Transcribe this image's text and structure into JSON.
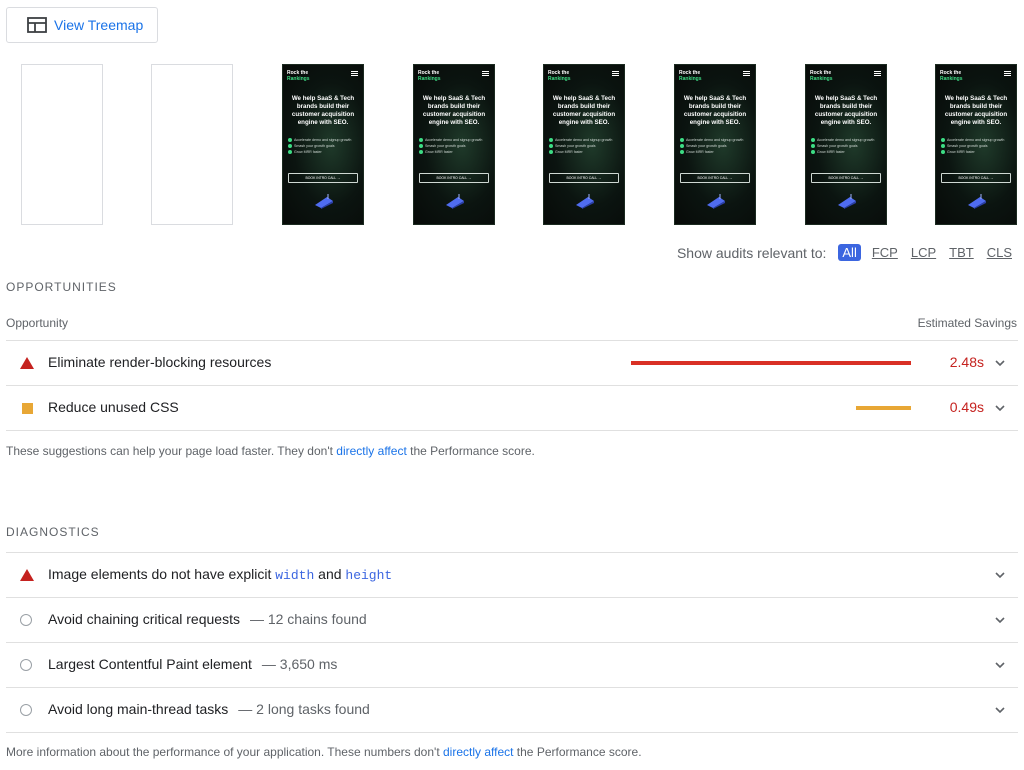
{
  "toolbar": {
    "treemap_label": "View Treemap"
  },
  "filmstrip": {
    "frames": [
      {
        "state": "blank"
      },
      {
        "state": "blank"
      },
      {
        "state": "rendered"
      },
      {
        "state": "rendered"
      },
      {
        "state": "rendered"
      },
      {
        "state": "rendered"
      },
      {
        "state": "rendered"
      },
      {
        "state": "rendered"
      }
    ],
    "preview": {
      "brand_line1": "Rock the",
      "brand_line2": "Rankings",
      "headline": "We help SaaS & Tech brands build their customer acquisition engine with SEO.",
      "bullets": [
        "Accelerate demo and signup growth",
        "Smash your growth goals",
        "Grow MRR faster"
      ],
      "cta": "BOOK INTRO CALL →"
    }
  },
  "filter": {
    "label": "Show audits relevant to:",
    "options": [
      "All",
      "FCP",
      "LCP",
      "TBT",
      "CLS"
    ],
    "active": "All"
  },
  "opportunities": {
    "title": "OPPORTUNITIES",
    "col_left": "Opportunity",
    "col_right": "Estimated Savings",
    "items": [
      {
        "title": "Eliminate render-blocking resources",
        "savings": "2.48s",
        "severity": "fail",
        "bar_color": "#d93025"
      },
      {
        "title": "Reduce unused CSS",
        "savings": "0.49s",
        "severity": "average",
        "bar_color": "#e8a735"
      }
    ],
    "note_before": "These suggestions can help your page load faster. They don't ",
    "note_link": "directly affect",
    "note_after": " the Performance score."
  },
  "diagnostics": {
    "title": "DIAGNOSTICS",
    "items": [
      {
        "title_pre": "Image elements do not have explicit ",
        "code1": "width",
        "mid": " and ",
        "code2": "height",
        "severity": "fail"
      },
      {
        "title": "Avoid chaining critical requests",
        "display": "— 12 chains found",
        "severity": "info"
      },
      {
        "title": "Largest Contentful Paint element",
        "display": "— 3,650 ms",
        "severity": "info"
      },
      {
        "title": "Avoid long main-thread tasks",
        "display": "— 2 long tasks found",
        "severity": "info"
      }
    ],
    "note_before": "More information about the performance of your application. These numbers don't ",
    "note_link": "directly affect",
    "note_after": " the Performance score."
  },
  "colors": {
    "fail": "#c5221f",
    "average": "#e8a735",
    "link": "#1a73e8",
    "filter_active": "#3c66e0"
  }
}
